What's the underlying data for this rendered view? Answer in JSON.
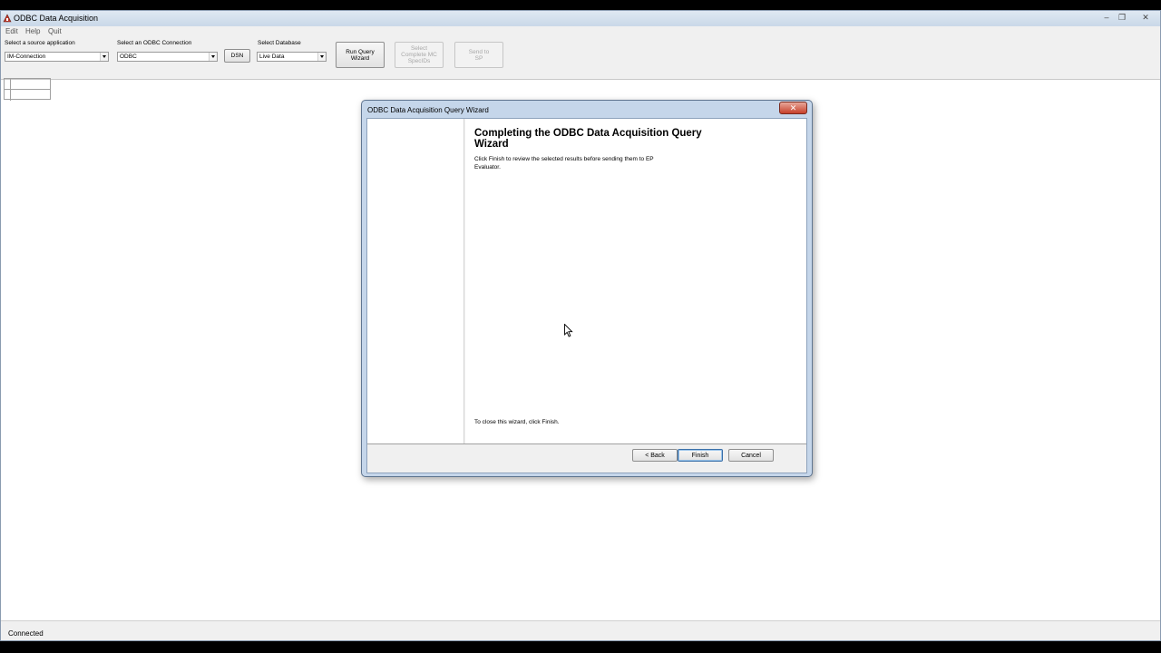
{
  "app": {
    "title": "ODBC Data Acquisition",
    "window_controls": {
      "minimize": "‒",
      "restore": "❐",
      "close": "✕"
    }
  },
  "menu": [
    "Edit",
    "Help",
    "Quit"
  ],
  "toolbar": {
    "source_label": "Select a source application",
    "source_value": "IM-Connection",
    "odbc_label": "Select an ODBC Connection",
    "odbc_value": "ODBC",
    "dsn_button": "DSN",
    "database_label": "Select Database",
    "database_value": "Live Data",
    "run_query_button": "Run Query Wizard",
    "select_complete_button": "Select Complete MC SpecIDs",
    "send_button": "Send to SP"
  },
  "status": {
    "text": "Connected"
  },
  "dialog": {
    "title": "ODBC Data Acquisition Query Wizard",
    "close": "✕",
    "heading": "Completing the ODBC Data Acquisition Query Wizard",
    "description": "Click Finish to review the selected results before sending them to EP Evaluator.",
    "close_instruction": "To close this wizard, click Finish.",
    "back_button": "< Back",
    "finish_button": "Finish",
    "cancel_button": "Cancel"
  }
}
